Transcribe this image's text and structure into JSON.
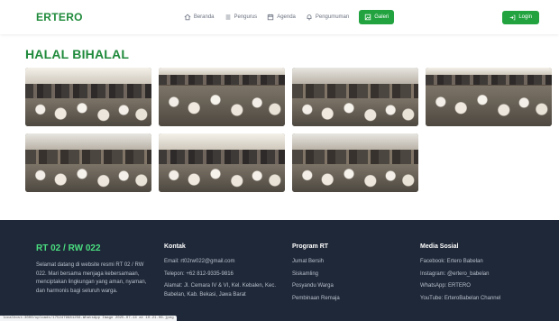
{
  "nav": {
    "brand": "ERTERO",
    "links": [
      {
        "label": "Beranda",
        "icon": "home-icon"
      },
      {
        "label": "Pengurus",
        "icon": "list-icon"
      },
      {
        "label": "Agenda",
        "icon": "calendar-icon"
      },
      {
        "label": "Pengumuman",
        "icon": "bell-icon"
      },
      {
        "label": "Galeri",
        "icon": "image-icon",
        "active": true
      }
    ],
    "login_label": "Login"
  },
  "main": {
    "title": "HALAL BIHALAL",
    "photo_count": 7
  },
  "footer": {
    "brand": "RT 02 / RW 022",
    "description": "Selamat datang di website resmi RT 02 / RW 022. Mari bersama menjaga kebersamaan, menciptakan lingkungan yang aman, nyaman, dan harmonis bagi seluruh warga.",
    "contact": {
      "heading": "Kontak",
      "email": "Email: rt02rw022@gmail.com",
      "phone": "Telepon: +62 812-9335-9816",
      "address": "Alamat: Jl. Cemara IV & VI, Kel. Kebalen, Kec. Babelan, Kab. Bekasi, Jawa Barat"
    },
    "program": {
      "heading": "Program RT",
      "items": [
        "Jumat Bersih",
        "Siskamling",
        "Posyandu Warga",
        "Pembinaan Remaja"
      ]
    },
    "social": {
      "heading": "Media Sosial",
      "items": [
        "Facebook: Ertero Babelan",
        "Instagram: @ertero_babelan",
        "WhatsApp: ERTERO",
        "YouTube: ErteroBabelan Channel"
      ]
    }
  },
  "status_url": "localhost:3000/uploads/1752479981256-WhatsApp Image 2025-07-14 at 10.21.06.jpeg",
  "colors": {
    "accent": "#22a33f",
    "brand": "#1f8a3b",
    "footer_bg": "#1f2838",
    "footer_brand": "#4ade80"
  }
}
